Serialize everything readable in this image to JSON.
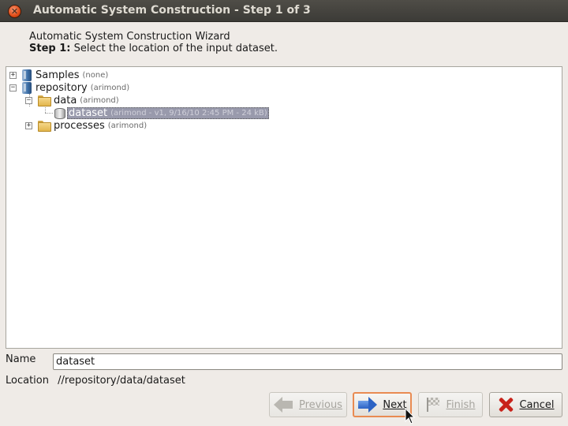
{
  "window": {
    "title": "Automatic System Construction - Step 1 of 3",
    "close_icon": "close-icon"
  },
  "header": {
    "wizard_title": "Automatic System Construction Wizard",
    "step_label": "Step 1:",
    "step_text": " Select the location of the input dataset."
  },
  "tree": {
    "samples": {
      "label": "Samples",
      "meta": "(none)",
      "icon": "repository-icon"
    },
    "repository": {
      "label": "repository",
      "meta": "(arimond)",
      "icon": "repository-icon"
    },
    "data": {
      "label": "data",
      "meta": "(arimond)",
      "icon": "folder-open-icon"
    },
    "dataset": {
      "label": "dataset",
      "meta": "(arimond - v1, 9/16/10 2:45 PM - 24 kB)",
      "icon": "database-icon",
      "selected": true
    },
    "processes": {
      "label": "processes",
      "meta": "(arimond)",
      "icon": "folder-icon"
    }
  },
  "form": {
    "name_label": "Name",
    "name_value": "dataset",
    "location_label": "Location",
    "location_value": "//repository/data/dataset"
  },
  "buttons": {
    "previous": "Previous",
    "next": "Next",
    "finish": "Finish",
    "cancel": "Cancel"
  },
  "colors": {
    "title_bar": "#3c3b37",
    "selection": "#999aac",
    "focus_border": "#e98b52",
    "cancel_icon": "#c8221a"
  }
}
